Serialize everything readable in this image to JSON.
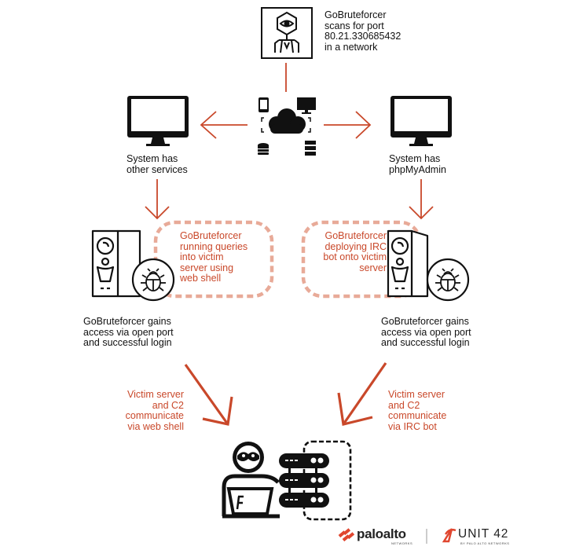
{
  "diagram": {
    "scanner": {
      "label": "GoBruteforcer\nscans for port\n80.21.330685432\nin a network",
      "icon": "virus-eye-icon"
    },
    "network": {
      "icon": "cloud-network-icon"
    },
    "left_branch": {
      "system_label": "System has\nother services",
      "action_label": "GoBruteforcer\nrunning queries\ninto victim\nserver using\nweb shell",
      "access_label": "GoBruteforcer gains\naccess via open port\nand successful login",
      "comm_label": "Victim server\nand C2\ncommunicate\nvia web shell"
    },
    "right_branch": {
      "system_label": "System has\nphpMyAdmin",
      "action_label": "GoBruteforcer\ndeploying IRC\nbot onto victim\nserver",
      "access_label": "GoBruteforcer gains\naccess via open port\nand successful login",
      "comm_label": "Victim server\nand C2\ncommunicate\nvia IRC bot"
    },
    "c2": {
      "icon": "hacker-server-icon"
    }
  },
  "branding": {
    "paloalto": "paloalto",
    "paloalto_sub": "NETWORKS",
    "unit42": "UNIT 42",
    "unit42_sub": "BY PALO ALTO NETWORKS"
  },
  "colors": {
    "accent": "#c9482a",
    "dashed": "#e8aa98",
    "ink": "#111111"
  }
}
